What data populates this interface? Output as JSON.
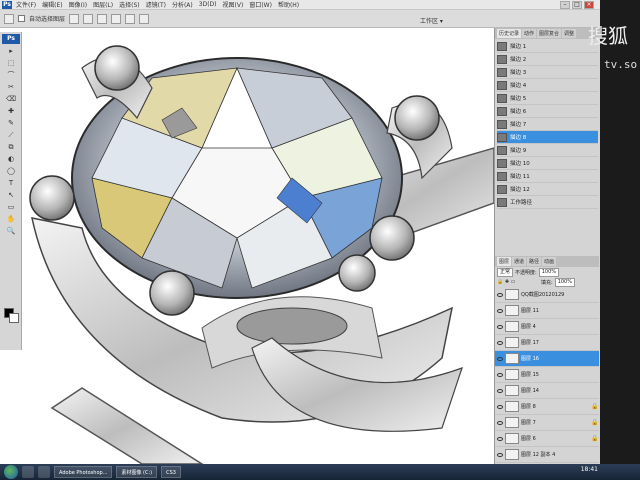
{
  "app": {
    "logo": "Ps"
  },
  "menu": {
    "items": [
      "文件(F)",
      "编辑(E)",
      "图像(I)",
      "图层(L)",
      "选择(S)",
      "滤镜(T)",
      "分析(A)",
      "3D(D)",
      "视图(V)",
      "窗口(W)",
      "帮助(H)"
    ]
  },
  "options": {
    "auto_select": "自动选择图层",
    "workspace": "工作区 ▾"
  },
  "tools": [
    "▸",
    "⬚",
    "⌒",
    "✂",
    "⌫",
    "✚",
    "✎",
    "⟋",
    "⧉",
    "◐",
    "◯",
    "T",
    "↖",
    "▭",
    "✋",
    "🔍"
  ],
  "colors": {
    "accent": "#3a8fde",
    "canvas_bg": "#ffffff",
    "metal_dark": "#4a4a4a",
    "metal_light": "#f2f2f2",
    "diamond_blue": "#7aa3d8",
    "diamond_yellow": "#d8c878"
  },
  "history": {
    "tabs": [
      "历史记录",
      "动作",
      "图层复合",
      "调整"
    ],
    "items": [
      {
        "label": "描边 1"
      },
      {
        "label": "描边 2"
      },
      {
        "label": "描边 3"
      },
      {
        "label": "描边 4"
      },
      {
        "label": "描边 5"
      },
      {
        "label": "描边 6"
      },
      {
        "label": "描边 7"
      },
      {
        "label": "描边 8",
        "selected": true
      },
      {
        "label": "描边 9"
      },
      {
        "label": "描边 10"
      },
      {
        "label": "描边 11"
      },
      {
        "label": "描边 12"
      },
      {
        "label": "工作路径"
      }
    ]
  },
  "layers": {
    "tabs": [
      "图层",
      "通道",
      "路径",
      "动画"
    ],
    "blend_mode": "正常",
    "opacity_label": "不透明度:",
    "opacity": "100%",
    "fill_label": "填充:",
    "fill": "100%",
    "items": [
      {
        "name": "QQ截图20120129"
      },
      {
        "name": "图层 11"
      },
      {
        "name": "图层 4"
      },
      {
        "name": "图层 17"
      },
      {
        "name": "图层 16",
        "selected": true
      },
      {
        "name": "图层 15"
      },
      {
        "name": "图层 14"
      },
      {
        "name": "图层 8"
      },
      {
        "name": "图层 7"
      },
      {
        "name": "图层 6"
      },
      {
        "name": "图层 12 副本 4"
      }
    ]
  },
  "watermark": {
    "line1": "搜狐",
    "line2": "tv.so"
  },
  "taskbar": {
    "items": [
      "Adobe Photoshop...",
      "素材图像 (C:)",
      "CS3"
    ],
    "clock": "18:41"
  }
}
